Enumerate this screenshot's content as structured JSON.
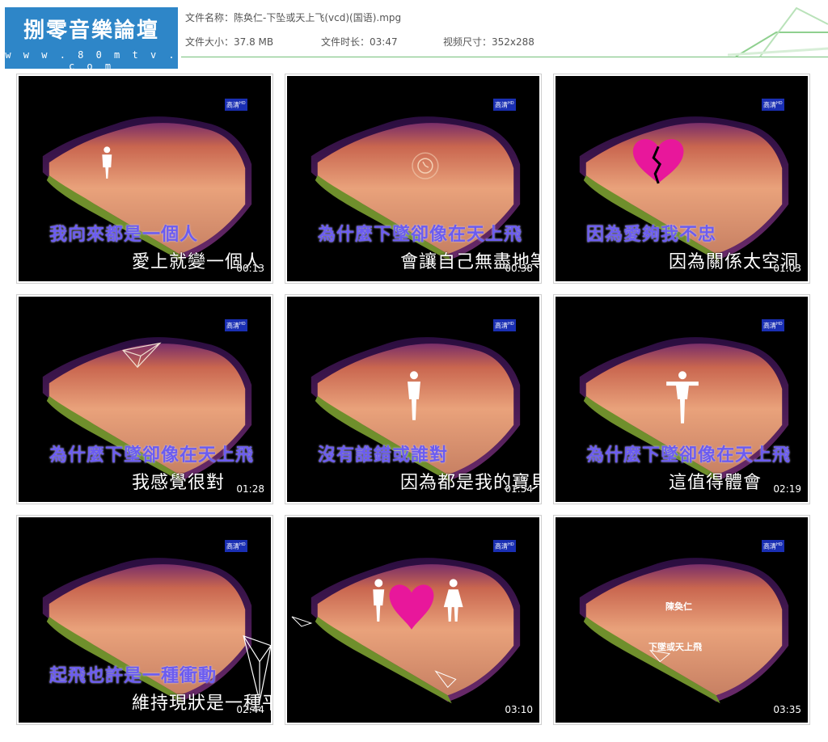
{
  "logo": {
    "title": "捌零音樂論壇",
    "url": "w w w . 8 0 m t v . c o m"
  },
  "file_info": {
    "name_label": "文件名称：",
    "name_value": "陈奂仁-下坠或天上飞(vcd)(国语).mpg",
    "size_label": "文件大小：",
    "size_value": "37.8 MB",
    "duration_label": "文件时长：",
    "duration_value": "03:47",
    "dimensions_label": "视频尺寸：",
    "dimensions_value": "352x288"
  },
  "badge": {
    "text": "高清",
    "sup": "HD"
  },
  "thumbnails": [
    {
      "timestamp": "00:13",
      "line1": "我向來都是一個人",
      "line2": "愛上就變一個人"
    },
    {
      "timestamp": "00:38",
      "line1": "為什麼下墜卻像在天上飛",
      "line2": "會讓自己無盡地等"
    },
    {
      "timestamp": "01:03",
      "line1": "因為愛夠我不忠",
      "line2": "因為關係太空洞"
    },
    {
      "timestamp": "01:28",
      "line1": "為什麼下墜卻像在天上飛",
      "line2": "我感覺很對"
    },
    {
      "timestamp": "01:54",
      "line1": "沒有誰錯或誰對",
      "line2": "因為都是我的寶貝"
    },
    {
      "timestamp": "02:19",
      "line1": "為什麼下墜卻像在天上飛",
      "line2": "這值得體會"
    },
    {
      "timestamp": "02:44",
      "line1": "起飛也許是一種衝動",
      "line2": "維持現狀是一種平衡"
    },
    {
      "timestamp": "03:10",
      "line1": "",
      "line2": ""
    },
    {
      "timestamp": "03:35",
      "line1": "",
      "line2": "",
      "credit_artist": "陳奐仁",
      "credit_title": "下墜或天上飛"
    }
  ],
  "colors": {
    "accent_line": "#74c07a",
    "logo_bg": "#2e86c8",
    "lyric_highlight": "#6b5cf0",
    "heart": "#e8179b"
  },
  "icons": [
    "person-icon",
    "heart-icon",
    "broken-heart-icon",
    "paper-plane-icon",
    "clock-icon"
  ]
}
